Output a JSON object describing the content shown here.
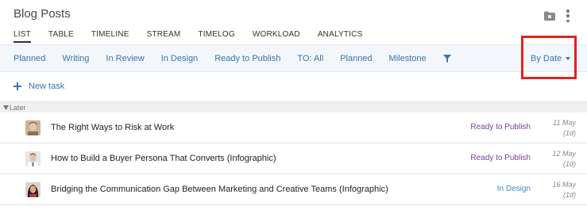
{
  "header": {
    "title": "Blog Posts",
    "icons": [
      "folder-icon",
      "kebab-menu-icon"
    ]
  },
  "views": [
    {
      "label": "LIST",
      "active": true
    },
    {
      "label": "TABLE",
      "active": false
    },
    {
      "label": "TIMELINE",
      "active": false
    },
    {
      "label": "STREAM",
      "active": false
    },
    {
      "label": "TIMELOG",
      "active": false
    },
    {
      "label": "WORKLOAD",
      "active": false
    },
    {
      "label": "ANALYTICS",
      "active": false
    }
  ],
  "filters": [
    "Planned",
    "Writing",
    "In Review",
    "In Design",
    "Ready to Publish",
    "TO: All",
    "Planned",
    "Milestone"
  ],
  "sort": {
    "label": "By Date",
    "highlighted": true
  },
  "new_task": {
    "label": "New task"
  },
  "group": {
    "label": "Later"
  },
  "tasks": [
    {
      "title": "The Right Ways to Risk at Work",
      "status": "Ready to Publish",
      "status_color": "#7a3fa3",
      "date": "11 May",
      "duration": "(1d)"
    },
    {
      "title": "How to Build a Buyer Persona That Converts (Infographic)",
      "status": "Ready to Publish",
      "status_color": "#7a3fa3",
      "date": "12 May",
      "duration": "(1d)"
    },
    {
      "title": "Bridging the Communication Gap Between Marketing and Creative Teams (Infographic)",
      "status": "In Design",
      "status_color": "#3a8ed4",
      "date": "16 May",
      "duration": "(1d)"
    }
  ],
  "colors": {
    "accent": "#3a74ad",
    "highlight_box": "#e0231c",
    "filterbar_bg": "#f3f7fb"
  }
}
